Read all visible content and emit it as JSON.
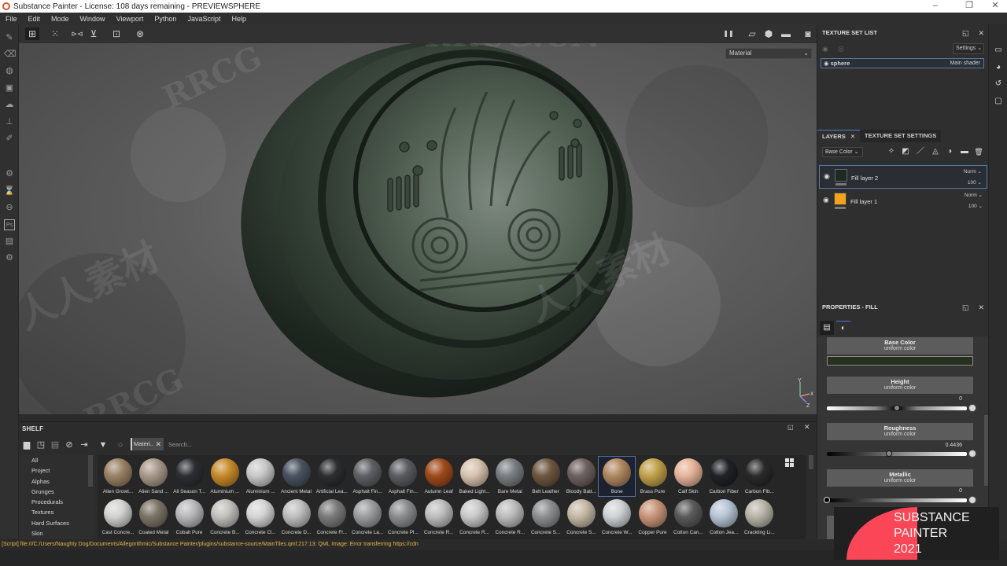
{
  "window": {
    "title": "Substance Painter - License: 108 days remaining - PREVIEWSPHERE",
    "controls": {
      "minimize": "–",
      "maximize": "❐",
      "close": "✕"
    }
  },
  "menubar": [
    "File",
    "Edit",
    "Mode",
    "Window",
    "Viewport",
    "Python",
    "JavaScript",
    "Help"
  ],
  "left_toolbar": [
    {
      "icon": "paint-brush-icon",
      "glyph": "✎"
    },
    {
      "icon": "eraser-icon",
      "glyph": "⌫"
    },
    {
      "icon": "projection-icon",
      "glyph": "◍"
    },
    {
      "icon": "geometry-fill-icon",
      "glyph": "▣"
    },
    {
      "icon": "smudge-icon",
      "glyph": "☁"
    },
    {
      "icon": "clone-stamp-icon",
      "glyph": "⊥"
    },
    {
      "icon": "color-picker-icon",
      "glyph": "✐"
    },
    {
      "icon": "bake-icon",
      "glyph": "⚙"
    },
    {
      "icon": "hourglass-icon",
      "glyph": "⌛"
    },
    {
      "icon": "material-picker-icon",
      "glyph": "⊖"
    },
    {
      "icon": "photoshop-export-icon",
      "glyph": "Ps"
    },
    {
      "icon": "document-icon",
      "glyph": "▤"
    },
    {
      "icon": "settings-icon",
      "glyph": "⚙"
    }
  ],
  "viewport_toolbar": {
    "left_icons": [
      {
        "icon": "grid-single-view-icon",
        "glyph": "⊞",
        "active": true
      },
      {
        "icon": "grid-multi-view-icon",
        "glyph": "⁙"
      },
      {
        "icon": "mirror-horizontal-icon",
        "glyph": "⊳⊲"
      },
      {
        "icon": "mirror-vertical-icon",
        "glyph": "⊻"
      },
      {
        "icon": "add-frame-icon",
        "glyph": "⊡"
      },
      {
        "icon": "reset-icon",
        "glyph": "⊗"
      }
    ],
    "right_icons": [
      {
        "icon": "pause-icon",
        "glyph": "❚❚"
      },
      {
        "icon": "display-2d-icon",
        "glyph": "▱"
      },
      {
        "icon": "display-3d-icon",
        "glyph": "⬢"
      },
      {
        "icon": "camera-icon",
        "glyph": "▬"
      },
      {
        "icon": "screenshot-icon",
        "glyph": "◙"
      }
    ],
    "render_mode": "Material"
  },
  "viewport": {
    "gizmo": {
      "y": "Y",
      "x": "X",
      "z": "Z"
    },
    "disc_color": "#2f3a30"
  },
  "texture_set_list": {
    "title": "TEXTURE SET LIST",
    "settings_label": "Settings",
    "items": [
      {
        "name": "sphere",
        "shader": "Main shader"
      }
    ]
  },
  "layers": {
    "tabs": [
      {
        "label": "LAYERS",
        "active": true
      },
      {
        "label": "TEXTURE SET SETTINGS",
        "active": false
      }
    ],
    "channel": "Base Color",
    "tools": [
      {
        "icon": "add-effect-icon",
        "glyph": "✧"
      },
      {
        "icon": "add-mask-icon",
        "glyph": "◩"
      },
      {
        "icon": "add-paint-layer-icon",
        "glyph": "／"
      },
      {
        "icon": "add-fill-layer-icon",
        "glyph": "◬"
      },
      {
        "icon": "add-smart-material-icon",
        "glyph": "◑"
      },
      {
        "icon": "add-folder-icon",
        "glyph": "▬"
      },
      {
        "icon": "delete-icon",
        "glyph": "🗑"
      }
    ],
    "items": [
      {
        "name": "Fill layer 2",
        "blend": "Norm",
        "opacity": "100",
        "thumb_color": "#1e2a20",
        "selected": true
      },
      {
        "name": "Fill layer 1",
        "blend": "Norm",
        "opacity": "100",
        "thumb_color": "#f3a21c",
        "selected": false
      }
    ]
  },
  "properties": {
    "title": "PROPERTIES - FILL",
    "channels": [
      {
        "name": "Base Color",
        "mode": "uniform color",
        "color": "#26311f"
      },
      {
        "name": "Height",
        "mode": "uniform color",
        "value": "0",
        "fraction": 0.5
      },
      {
        "name": "Roughness",
        "mode": "uniform color",
        "value": "0.4436",
        "fraction": 0.4436
      },
      {
        "name": "Metallic",
        "mode": "uniform color",
        "value": "0",
        "fraction": 0.0
      }
    ]
  },
  "right_rail": [
    {
      "icon": "display-settings-icon",
      "glyph": "▭"
    },
    {
      "icon": "shader-settings-icon",
      "glyph": "◕"
    },
    {
      "icon": "history-icon",
      "glyph": "↺"
    },
    {
      "icon": "log-icon",
      "glyph": "▢"
    }
  ],
  "shelf": {
    "title": "SHELF",
    "toolbar_icons": [
      {
        "icon": "folder-icon",
        "glyph": "▆"
      },
      {
        "icon": "new-shelf-icon",
        "glyph": "◳"
      },
      {
        "icon": "database-icon",
        "glyph": "▤"
      },
      {
        "icon": "hide-icon",
        "glyph": "⊘"
      },
      {
        "icon": "import-icon",
        "glyph": "⇥"
      }
    ],
    "filter_chip": "Materi..",
    "search_placeholder": "Search...",
    "categories": [
      "All",
      "Project",
      "Alphas",
      "Grunges",
      "Procedurals",
      "Textures",
      "Hard Surfaces",
      "Skin"
    ],
    "materials_row1": [
      {
        "name": "Alien Growt...",
        "color": "#9a8266"
      },
      {
        "name": "Alien Sand ...",
        "color": "#a8998a"
      },
      {
        "name": "All Season T...",
        "color": "#2e2f33"
      },
      {
        "name": "Aluminium ...",
        "color": "#c78a2a"
      },
      {
        "name": "Aluminium ...",
        "color": "#c8c8c8"
      },
      {
        "name": "Ancient Metal",
        "color": "#4a5360"
      },
      {
        "name": "Artificial Lea...",
        "color": "#2c2e30"
      },
      {
        "name": "Asphalt Fin...",
        "color": "#5e6064"
      },
      {
        "name": "Asphalt Fin...",
        "color": "#5a5c60"
      },
      {
        "name": "Autumn Leaf",
        "color": "#a04a1c"
      },
      {
        "name": "Baked Light...",
        "color": "#d8c2ae"
      },
      {
        "name": "Bare Metal",
        "color": "#7a7d82"
      },
      {
        "name": "Belt Leather",
        "color": "#6e5640"
      },
      {
        "name": "Bloody Batt...",
        "color": "#6e6260"
      },
      {
        "name": "Bone",
        "color": "#b08860",
        "selected": true
      },
      {
        "name": "Brass Pure",
        "color": "#c0a04a"
      },
      {
        "name": "Calf Skin",
        "color": "#e6b49a"
      },
      {
        "name": "Carbon Fiber",
        "color": "#202226"
      },
      {
        "name": "Carbon Fib...",
        "color": "#2a2a2a"
      }
    ],
    "materials_row2": [
      {
        "name": "Cast Concre...",
        "color": "#d2d2d0"
      },
      {
        "name": "Coated Metal",
        "color": "#7c7466"
      },
      {
        "name": "Cobalt Pure",
        "color": "#b8b8ba"
      },
      {
        "name": "Concrete B...",
        "color": "#c2c0bc"
      },
      {
        "name": "Concrete Cl...",
        "color": "#d4d4d4"
      },
      {
        "name": "Concrete D...",
        "color": "#bebebe"
      },
      {
        "name": "Concrete Fl...",
        "color": "#7a7a7a"
      },
      {
        "name": "Concrete La...",
        "color": "#9a9c9e"
      },
      {
        "name": "Concrete Pl...",
        "color": "#8a8c8e"
      },
      {
        "name": "Concrete R...",
        "color": "#bdbdbd"
      },
      {
        "name": "Concrete R...",
        "color": "#c8c8c8"
      },
      {
        "name": "Concrete R...",
        "color": "#bcbcbc"
      },
      {
        "name": "Concrete S...",
        "color": "#8c8e90"
      },
      {
        "name": "Concrete S...",
        "color": "#c4b8a4"
      },
      {
        "name": "Concrete W...",
        "color": "#cfd2d4"
      },
      {
        "name": "Copper Pure",
        "color": "#c89478"
      },
      {
        "name": "Cotton Can...",
        "color": "#5a5a5a"
      },
      {
        "name": "Cotton Jea...",
        "color": "#b6c4d4"
      },
      {
        "name": "Crackling Li...",
        "color": "#b8b4a8"
      }
    ]
  },
  "status": {
    "message": "[Script] file:///C:/Users/Naughty Dog/Documents/Allegorithmic/Substance Painter/plugins/substance-source/MainTiles.qml:217:13: QML Image: Error transferring https://cdn"
  },
  "badge": {
    "lines": [
      "SUBSTANCE",
      "PAINTER",
      "2021"
    ],
    "accent": "#fa4656"
  },
  "watermarks": [
    "RRCG.CN",
    "人人素材",
    "RRCG"
  ]
}
